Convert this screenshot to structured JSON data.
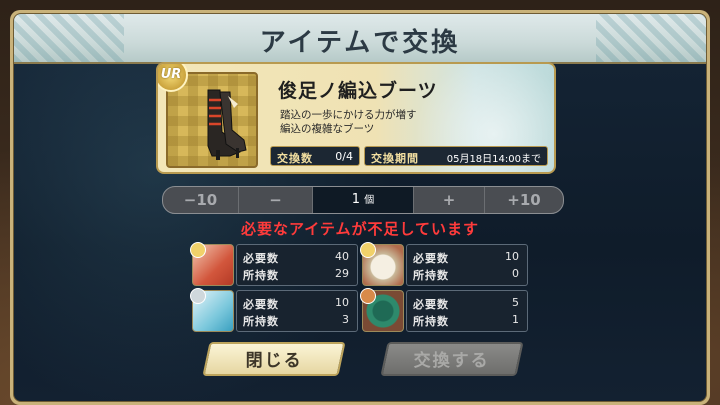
{
  "dialog": {
    "title": "アイテムで交換"
  },
  "item": {
    "rarity_badge": "UR",
    "name": "俊足ノ編込ブーツ",
    "description_line1": "踏込の一歩にかける力が増す",
    "description_line2": "編込の複雑なブーツ",
    "exchange_count_label": "交換数",
    "exchange_count_value": "0/4",
    "exchange_period_label": "交換期間",
    "exchange_period_value": "05月18日14:00まで",
    "icon": "boot-icon"
  },
  "quantity": {
    "minus10": "−10",
    "minus": "−",
    "value": "1",
    "unit": "個",
    "plus": "+",
    "plus10": "+10"
  },
  "warning": "必要なアイテムが不足しています",
  "requirements": [
    {
      "icon": "red-cloth-icon",
      "required_label": "必要数",
      "required": "40",
      "owned_label": "所持数",
      "owned": "29"
    },
    {
      "icon": "mask-icon",
      "required_label": "必要数",
      "required": "10",
      "owned_label": "所持数",
      "owned": "0"
    },
    {
      "icon": "blue-cloth-icon",
      "required_label": "必要数",
      "required": "10",
      "owned_label": "所持数",
      "owned": "3"
    },
    {
      "icon": "green-emblem-icon",
      "required_label": "必要数",
      "required": "5",
      "owned_label": "所持数",
      "owned": "1"
    }
  ],
  "buttons": {
    "close": "閉じる",
    "exchange": "交換する"
  },
  "colors": {
    "warning": "#ff3b3b",
    "panel": "#18232f",
    "gold": "#b89a50"
  }
}
